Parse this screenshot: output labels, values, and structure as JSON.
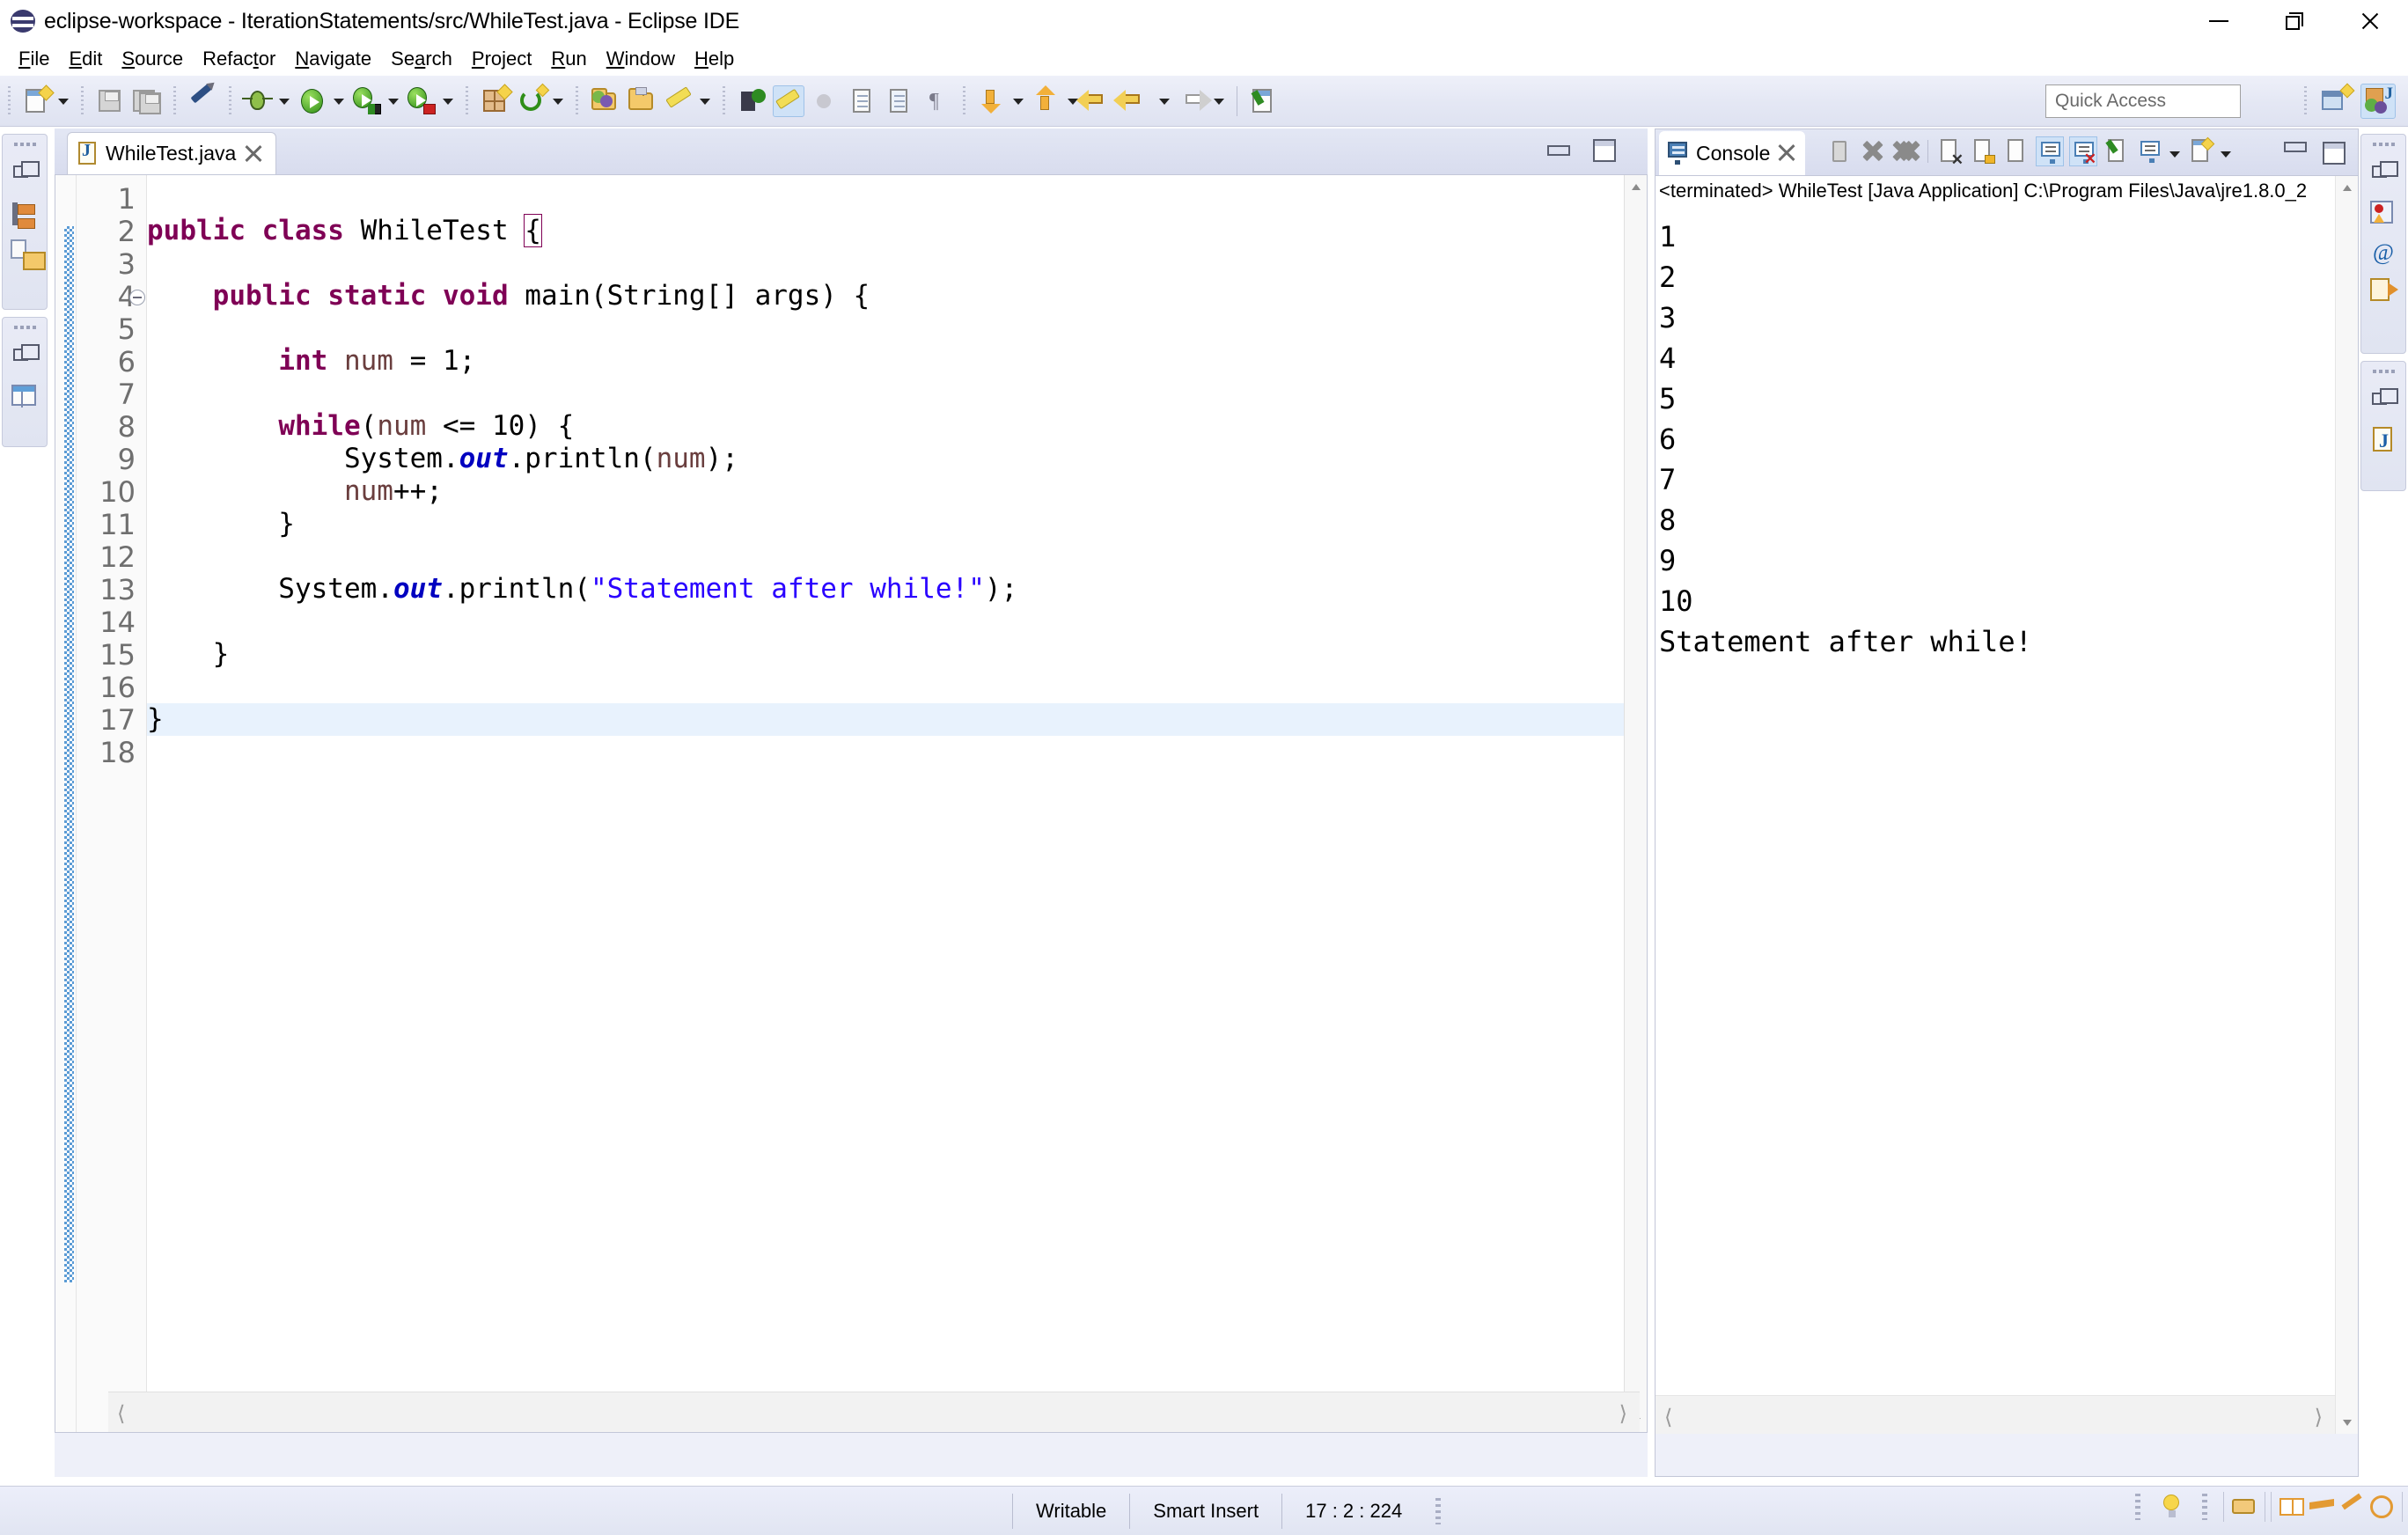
{
  "window": {
    "title": "eclipse-workspace - IterationStatements/src/WhileTest.java - Eclipse IDE",
    "logo_icon": "eclipse-logo",
    "controls": [
      {
        "name": "minimize-button",
        "icon": "minimize-icon"
      },
      {
        "name": "maximize-button",
        "icon": "maximize-icon"
      },
      {
        "name": "close-button",
        "icon": "close-icon"
      }
    ]
  },
  "menubar": {
    "items": [
      {
        "label": "File",
        "mnemonic": "F"
      },
      {
        "label": "Edit",
        "mnemonic": "E"
      },
      {
        "label": "Source",
        "mnemonic": "S"
      },
      {
        "label": "Refactor",
        "mnemonic": "t"
      },
      {
        "label": "Navigate",
        "mnemonic": "N"
      },
      {
        "label": "Search",
        "mnemonic": "a"
      },
      {
        "label": "Project",
        "mnemonic": "P"
      },
      {
        "label": "Run",
        "mnemonic": "R"
      },
      {
        "label": "Window",
        "mnemonic": "W"
      },
      {
        "label": "Help",
        "mnemonic": "H"
      }
    ]
  },
  "toolbar": {
    "icons": [
      "new-wizard-icon",
      "new-wizard-dropdown",
      "save-icon",
      "save-all-icon",
      "no-edit-icon",
      "debug-icon",
      "debug-dropdown",
      "run-icon",
      "run-dropdown",
      "run-coverage-icon",
      "run-coverage-dropdown",
      "run-last-tool-icon",
      "run-last-tool-dropdown",
      "new-java-package-icon",
      "new-java-class-icon",
      "new-class-dropdown",
      "open-type-icon",
      "open-task-icon",
      "marker-icon",
      "marker-dropdown",
      "search-icon",
      "toggle-mark-occurrences-icon",
      "skip-breakpoints-icon",
      "next-annotation-icon",
      "previous-annotation-icon",
      "show-whitespace-icon",
      "next-edit-icon",
      "next-edit-dropdown",
      "previous-edit-icon",
      "previous-edit-dropdown",
      "back-icon",
      "back-dropdown",
      "forward-icon",
      "forward-dropdown",
      "new-editor-icon"
    ]
  },
  "quick_access": {
    "placeholder": "Quick Access",
    "value": "",
    "name": "quick-access-input"
  },
  "perspectives": [
    {
      "name": "open-perspective-icon",
      "active": false
    },
    {
      "name": "java-perspective-icon",
      "label": "Java",
      "active": true
    }
  ],
  "sidebar_left": {
    "groups": [
      {
        "icons": [
          "restore-icon",
          "package-explorer-icon",
          "navigator-icon"
        ]
      },
      {
        "icons": [
          "restore-icon",
          "outline-view-icon"
        ]
      }
    ]
  },
  "sidebar_right": {
    "groups": [
      {
        "icons": [
          "restore-icon",
          "problems-view-icon",
          "javadoc-icon",
          "declaration-icon"
        ]
      },
      {
        "icons": [
          "restore-icon",
          "java-file-icon"
        ]
      }
    ]
  },
  "editor": {
    "tab": {
      "label": "WhileTest.java",
      "icon": "java-file-icon",
      "close_icon": "close-icon",
      "active": true
    },
    "view_buttons": [
      "minimize-view-icon",
      "maximize-view-icon"
    ],
    "scroll": {
      "vertical_up": "scroll-up-icon",
      "vertical_down": "scroll-down-icon",
      "horizontal_left": "scroll-left-icon",
      "horizontal_right": "scroll-right-icon"
    },
    "current_line": 17,
    "fold_lines": [
      4
    ],
    "lines": [
      {
        "n": 1,
        "tokens": []
      },
      {
        "n": 2,
        "tokens": [
          {
            "t": "public",
            "c": "kw"
          },
          {
            "t": " ",
            "c": ""
          },
          {
            "t": "class",
            "c": "kw"
          },
          {
            "t": " WhileTest ",
            "c": ""
          },
          {
            "t": "{",
            "c": "brace"
          }
        ]
      },
      {
        "n": 3,
        "tokens": []
      },
      {
        "n": 4,
        "tokens": [
          {
            "t": "    ",
            "c": ""
          },
          {
            "t": "public",
            "c": "kw"
          },
          {
            "t": " ",
            "c": ""
          },
          {
            "t": "static",
            "c": "kw"
          },
          {
            "t": " ",
            "c": ""
          },
          {
            "t": "void",
            "c": "kw"
          },
          {
            "t": " main(String[] args) {",
            "c": ""
          }
        ]
      },
      {
        "n": 5,
        "tokens": []
      },
      {
        "n": 6,
        "tokens": [
          {
            "t": "        ",
            "c": ""
          },
          {
            "t": "int",
            "c": "kw"
          },
          {
            "t": " ",
            "c": ""
          },
          {
            "t": "num",
            "c": "lcl"
          },
          {
            "t": " = 1;",
            "c": ""
          }
        ]
      },
      {
        "n": 7,
        "tokens": []
      },
      {
        "n": 8,
        "tokens": [
          {
            "t": "        ",
            "c": ""
          },
          {
            "t": "while",
            "c": "kw"
          },
          {
            "t": "(",
            "c": ""
          },
          {
            "t": "num",
            "c": "lcl"
          },
          {
            "t": " <= 10) {",
            "c": ""
          }
        ]
      },
      {
        "n": 9,
        "tokens": [
          {
            "t": "            System.",
            "c": ""
          },
          {
            "t": "out",
            "c": "fld"
          },
          {
            "t": ".println(",
            "c": ""
          },
          {
            "t": "num",
            "c": "lcl"
          },
          {
            "t": ");",
            "c": ""
          }
        ]
      },
      {
        "n": 10,
        "tokens": [
          {
            "t": "            ",
            "c": ""
          },
          {
            "t": "num",
            "c": "lcl"
          },
          {
            "t": "++;",
            "c": ""
          }
        ]
      },
      {
        "n": 11,
        "tokens": [
          {
            "t": "        }",
            "c": ""
          }
        ]
      },
      {
        "n": 12,
        "tokens": []
      },
      {
        "n": 13,
        "tokens": [
          {
            "t": "        System.",
            "c": ""
          },
          {
            "t": "out",
            "c": "fld"
          },
          {
            "t": ".println(",
            "c": ""
          },
          {
            "t": "\"Statement after while!\"",
            "c": "str"
          },
          {
            "t": ");",
            "c": ""
          }
        ]
      },
      {
        "n": 14,
        "tokens": []
      },
      {
        "n": 15,
        "tokens": [
          {
            "t": "    }",
            "c": ""
          }
        ]
      },
      {
        "n": 16,
        "tokens": []
      },
      {
        "n": 17,
        "tokens": [
          {
            "t": "}",
            "c": ""
          }
        ]
      },
      {
        "n": 18,
        "tokens": []
      }
    ]
  },
  "console": {
    "tab": {
      "label": "Console",
      "icon": "console-icon",
      "close_icon": "close-icon"
    },
    "toolbar_icons": [
      "terminate-icon",
      "remove-launch-icon",
      "remove-all-terminated-icon",
      "clear-console-icon",
      "scroll-lock-icon",
      "word-wrap-icon",
      "show-console-on-output-icon",
      "show-console-on-error-icon",
      "pin-console-icon",
      "display-selected-console-icon",
      "display-console-dropdown",
      "open-console-icon",
      "open-console-dropdown"
    ],
    "view_buttons": [
      "minimize-view-icon",
      "maximize-view-icon"
    ],
    "terminated_line": "<terminated> WhileTest [Java Application] C:\\Program Files\\Java\\jre1.8.0_2",
    "output": [
      "1",
      "2",
      "3",
      "4",
      "5",
      "6",
      "7",
      "8",
      "9",
      "10",
      "Statement after while!"
    ]
  },
  "statusbar": {
    "writable": "Writable",
    "insert_mode": "Smart Insert",
    "position": "17 : 2 : 224",
    "right_icons": [
      "quick-fix-bulb-icon",
      "drag-view-icon",
      "book-icon",
      "graduation-cap-icon",
      "wand-icon",
      "seal-icon"
    ]
  },
  "colors": {
    "keyword": "#7f0055",
    "string": "#2a00ff",
    "field": "#0000c0",
    "local_var": "#6a3e3e",
    "current_line_highlight": "#e8f2fd",
    "toolbar_bg": "#e4e7f4",
    "selection_blue": "#cfe2f7"
  }
}
